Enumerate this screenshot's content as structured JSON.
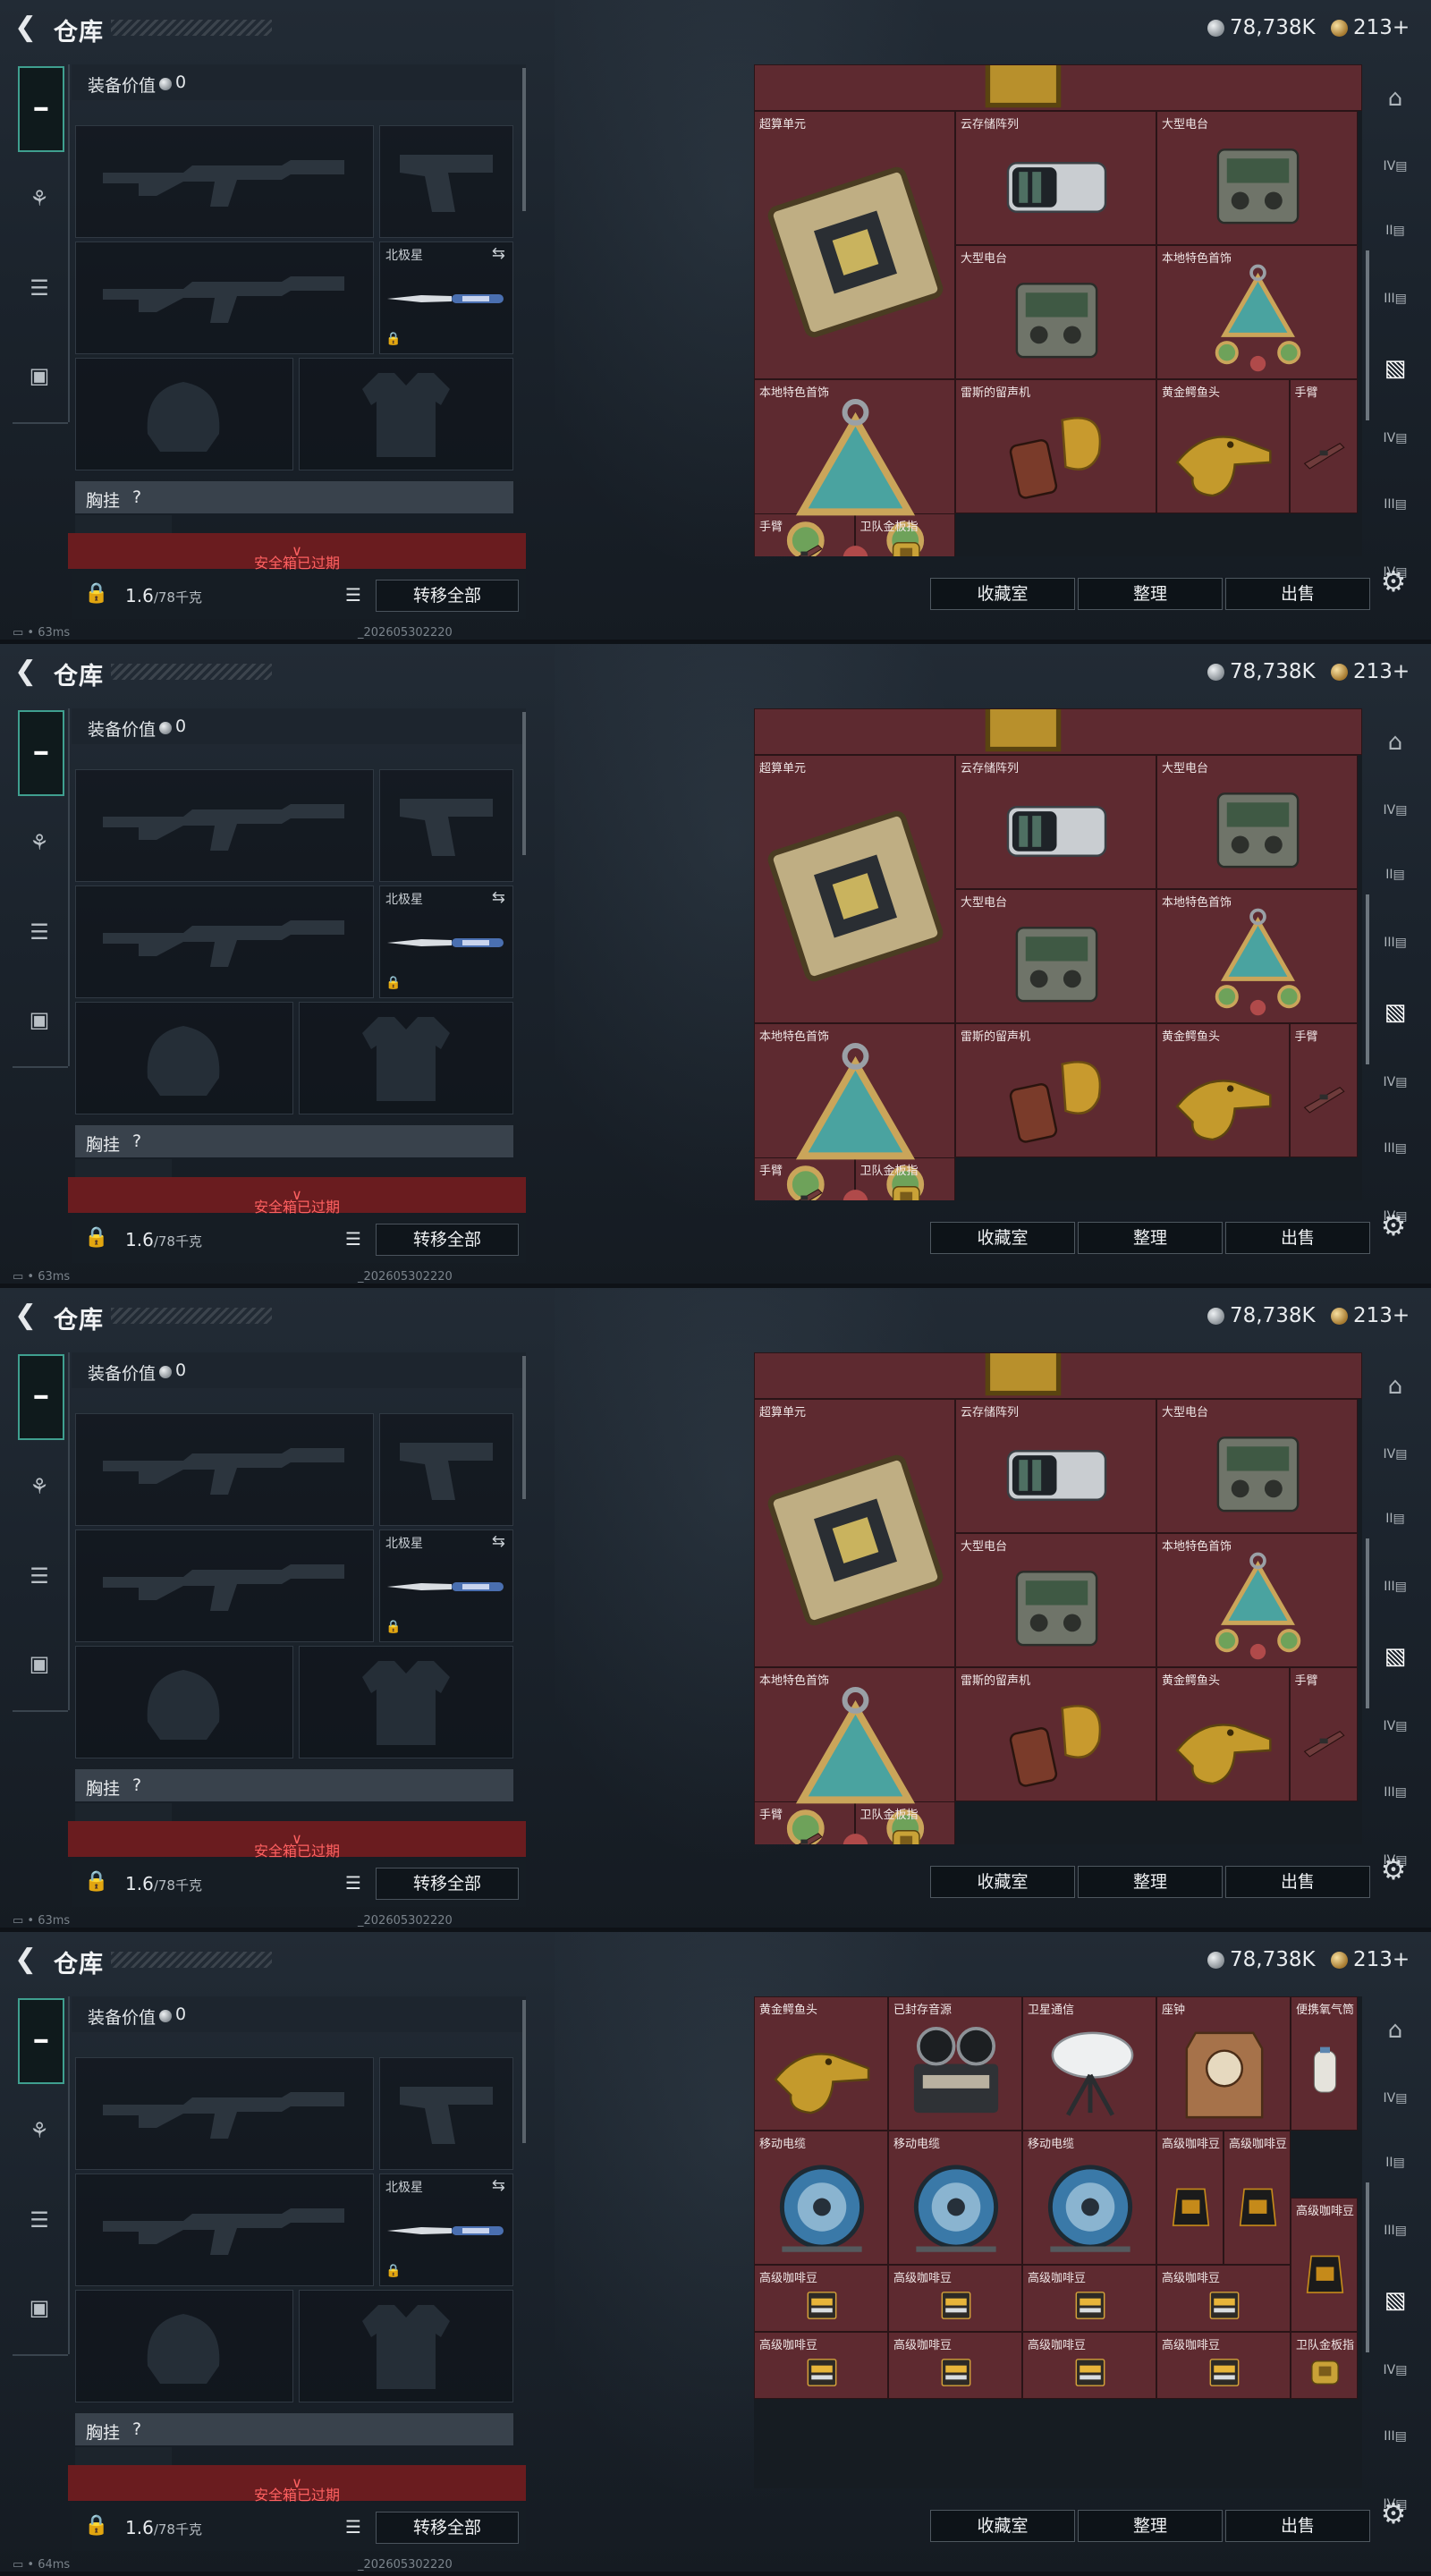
{
  "header": {
    "title": "仓库",
    "silver": "78,738K",
    "gold": "213+"
  },
  "equipment": {
    "value_label": "装备价值",
    "value": "0",
    "knife_label": "北极星",
    "chest_label": "胸挂",
    "chest_value": "?",
    "safebox_expired": "安全箱已过期",
    "weight_current": "1.6",
    "weight_max": "/78千克",
    "transfer_all": "转移全部"
  },
  "storage_buttons": {
    "collection": "收藏室",
    "sort": "整理",
    "sell": "出售"
  },
  "frames": [
    {
      "status": "63ms",
      "build": "_202605302220",
      "items": [
        {
          "name": "超算单元"
        },
        {
          "name": "云存储阵列"
        },
        {
          "name": "大型电台"
        },
        {
          "name": "大型电台"
        },
        {
          "name": "本地特色首饰"
        },
        {
          "name": "本地特色首饰"
        },
        {
          "name": "雷斯的留声机"
        },
        {
          "name": "黄金鳄鱼头"
        },
        {
          "name": "手臂"
        },
        {
          "name": "手臂"
        },
        {
          "name": "卫队金板指"
        }
      ]
    },
    {
      "status": "63ms",
      "build": "_202605302220",
      "items": [
        {
          "name": "超算单元"
        },
        {
          "name": "云存储阵列"
        },
        {
          "name": "大型电台"
        },
        {
          "name": "大型电台"
        },
        {
          "name": "本地特色首饰"
        },
        {
          "name": "本地特色首饰"
        },
        {
          "name": "雷斯的留声机"
        },
        {
          "name": "黄金鳄鱼头"
        },
        {
          "name": "手臂"
        },
        {
          "name": "手臂"
        },
        {
          "name": "卫队金板指"
        }
      ]
    },
    {
      "status": "63ms",
      "build": "_202605302220",
      "items": [
        {
          "name": "超算单元"
        },
        {
          "name": "云存储阵列"
        },
        {
          "name": "大型电台"
        },
        {
          "name": "大型电台"
        },
        {
          "name": "本地特色首饰"
        },
        {
          "name": "本地特色首饰"
        },
        {
          "name": "雷斯的留声机"
        },
        {
          "name": "黄金鳄鱼头"
        },
        {
          "name": "手臂"
        },
        {
          "name": "手臂"
        },
        {
          "name": "卫队金板指"
        }
      ]
    },
    {
      "status": "64ms",
      "build": "_202605302220",
      "items": [
        {
          "name": "黄金鳄鱼头"
        },
        {
          "name": "已封存音源"
        },
        {
          "name": "卫星通信"
        },
        {
          "name": "座钟"
        },
        {
          "name": "便携氧气筒"
        },
        {
          "name": "移动电缆"
        },
        {
          "name": "移动电缆"
        },
        {
          "name": "移动电缆"
        },
        {
          "name": "高级咖啡豆"
        },
        {
          "name": "高级咖啡豆"
        },
        {
          "name": "高级咖啡豆"
        },
        {
          "name": "高级咖啡豆"
        },
        {
          "name": "高级咖啡豆"
        },
        {
          "name": "高级咖啡豆"
        },
        {
          "name": "高级咖啡豆"
        },
        {
          "name": "高级咖啡豆"
        },
        {
          "name": "高级咖啡豆"
        },
        {
          "name": "高级咖啡豆"
        },
        {
          "name": "高级咖啡豆"
        },
        {
          "name": "卫队金板指"
        }
      ]
    }
  ],
  "icons": {
    "back": "back-arrow-icon",
    "weapon_tab": "gun-icon",
    "silver": "silver-coin-icon",
    "gold": "gold-coin-icon"
  }
}
